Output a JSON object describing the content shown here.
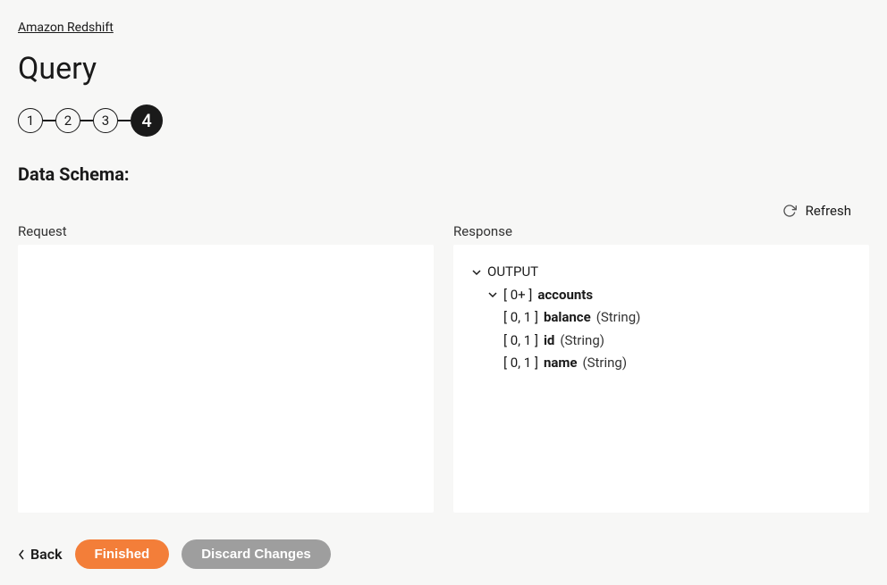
{
  "breadcrumb": "Amazon Redshift",
  "pageTitle": "Query",
  "stepper": {
    "steps": [
      "1",
      "2",
      "3",
      "4"
    ],
    "activeIndex": 3
  },
  "sectionHeading": "Data Schema:",
  "refreshLabel": "Refresh",
  "panels": {
    "request": {
      "label": "Request"
    },
    "response": {
      "label": "Response",
      "tree": {
        "root": {
          "label": "OUTPUT"
        },
        "child": {
          "cardinality": "[ 0+ ]",
          "name": "accounts"
        },
        "fields": [
          {
            "cardinality": "[ 0, 1 ]",
            "name": "balance",
            "type": "(String)"
          },
          {
            "cardinality": "[ 0, 1 ]",
            "name": "id",
            "type": "(String)"
          },
          {
            "cardinality": "[ 0, 1 ]",
            "name": "name",
            "type": "(String)"
          }
        ]
      }
    }
  },
  "footer": {
    "back": "Back",
    "finished": "Finished",
    "discard": "Discard Changes"
  }
}
